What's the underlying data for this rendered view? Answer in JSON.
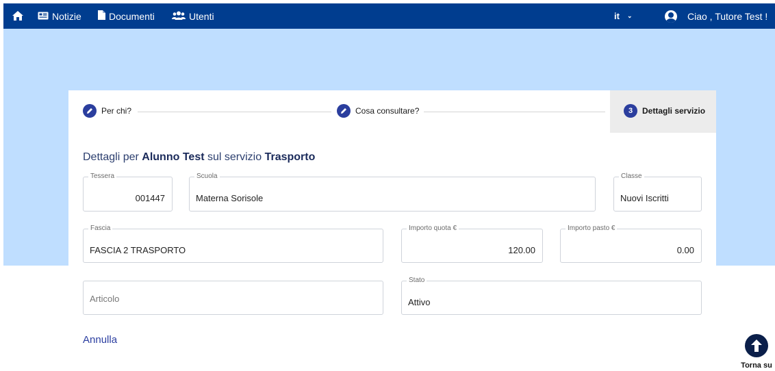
{
  "nav": {
    "home_icon": "home-icon",
    "notizie": "Notizie",
    "documenti": "Documenti",
    "utenti": "Utenti",
    "language": "it",
    "greeting": "Ciao , Tutore Test !"
  },
  "stepper": {
    "steps": [
      {
        "label": "Per chi?",
        "icon": "pencil-icon"
      },
      {
        "label": "Cosa consultare?",
        "icon": "pencil-icon"
      },
      {
        "label": "Dettagli servizio",
        "number": "3"
      }
    ]
  },
  "details": {
    "title_prefix": "Dettagli per",
    "alunno_label": "Alunno",
    "alunno_name": "Test",
    "servizio_text": "sul servizio",
    "servizio_name": "Trasporto"
  },
  "fields": {
    "tessera": {
      "label": "Tessera",
      "value": "001447"
    },
    "scuola": {
      "label": "Scuola",
      "value": "Materna Sorisole"
    },
    "classe": {
      "label": "Classe",
      "value": "Nuovi Iscritti"
    },
    "fascia": {
      "label": "Fascia",
      "value": "FASCIA 2 TRASPORTO"
    },
    "importo_quota": {
      "label": "Importo quota €",
      "value": "120.00"
    },
    "importo_pasto": {
      "label": "Importo pasto €",
      "value": "0.00"
    },
    "articolo": {
      "placeholder": "Articolo"
    },
    "stato": {
      "label": "Stato",
      "value": "Attivo"
    }
  },
  "actions": {
    "annulla": "Annulla",
    "torna_su": "Torna su"
  },
  "colors": {
    "navbar": "#003d8f",
    "banner": "#bfdeff",
    "accent": "#2b3e9e"
  }
}
